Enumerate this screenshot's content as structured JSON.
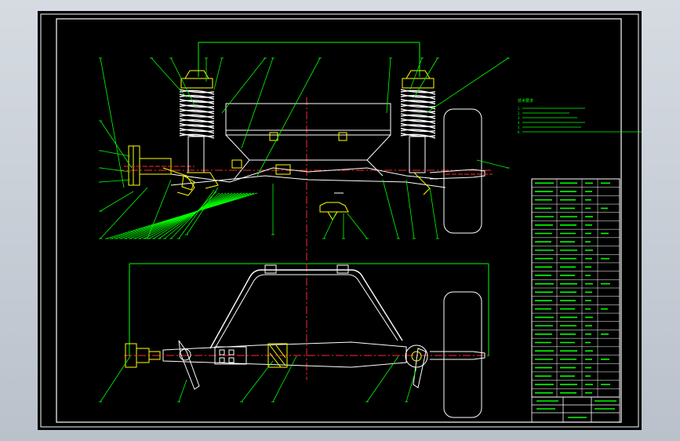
{
  "drawing": {
    "name": "front-suspension-assembly",
    "background": "#000000",
    "frame_color": "#ffffff",
    "line_colors": {
      "outline": "#ffffff",
      "leader": "#00ff00",
      "centerline": "#ff2a2a",
      "part": "#ffff00",
      "spring": "#ffffff"
    }
  },
  "tech_notes": {
    "heading": "技术要求",
    "lines": [
      "1.",
      "2.",
      "3.",
      "4.",
      "5.",
      "6."
    ]
  },
  "bom": {
    "rows": 26,
    "columns": 4,
    "header_labels": [
      "",
      "",
      "",
      ""
    ]
  },
  "title_block": {
    "title": "",
    "scale_text": ""
  },
  "dimensions": {
    "top_overall": "",
    "bottom_overall": ""
  }
}
